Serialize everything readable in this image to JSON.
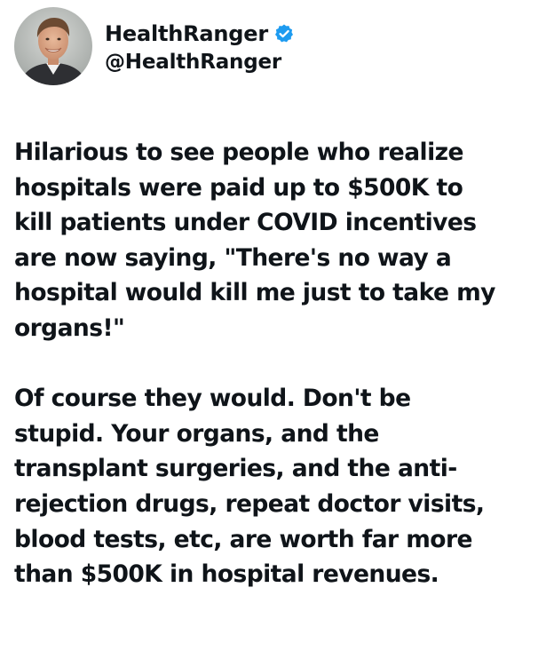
{
  "author": {
    "display_name": "HealthRanger",
    "handle": "@HealthRanger",
    "avatar_icon": "profile-photo-avatar",
    "verified_icon": "verified-badge-icon",
    "verified_color": "#1d9bf0"
  },
  "tweet": {
    "paragraphs": [
      {
        "lines": [
          "Hilarious to see people who realize",
          "hospitals were paid up to $500K to",
          "kill patients under COVID incentives",
          "are now saying, \"There's no way a",
          "hospital would kill me just to take my",
          "organs!\""
        ]
      },
      {
        "lines": [
          "Of course they would. Don't be",
          "stupid. Your organs, and the",
          "transplant surgeries, and the anti-",
          "rejection drugs, repeat doctor visits,",
          "blood tests, etc, are worth far more",
          "than $500K in hospital revenues."
        ]
      }
    ]
  }
}
